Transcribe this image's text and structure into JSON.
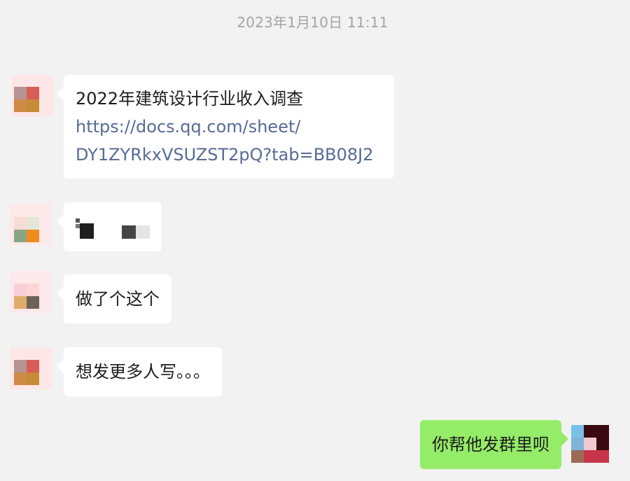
{
  "chat": {
    "timestamp": "2023年1月10日 11:11",
    "messages": [
      {
        "sender": "other",
        "title": "2022年建筑设计行业收入调查",
        "link_line1": "https://docs.qq.com/sheet/",
        "link_line2": "DY1ZYRkxVSUZST2pQ?tab=BB08J2"
      },
      {
        "sender": "other",
        "text": "",
        "redacted": true
      },
      {
        "sender": "other",
        "text": "做了个这个"
      },
      {
        "sender": "other",
        "text": "想发更多人写。。。"
      },
      {
        "sender": "self",
        "text": "你帮他发群里呗"
      }
    ]
  },
  "colors": {
    "background": "#f2f2f2",
    "incoming_bubble": "#ffffff",
    "outgoing_bubble": "#95ec69",
    "link": "#576b95",
    "timestamp": "#a3a3a3"
  },
  "icons": [
    "avatar-pixelated",
    "redacted-pixelated-content"
  ]
}
